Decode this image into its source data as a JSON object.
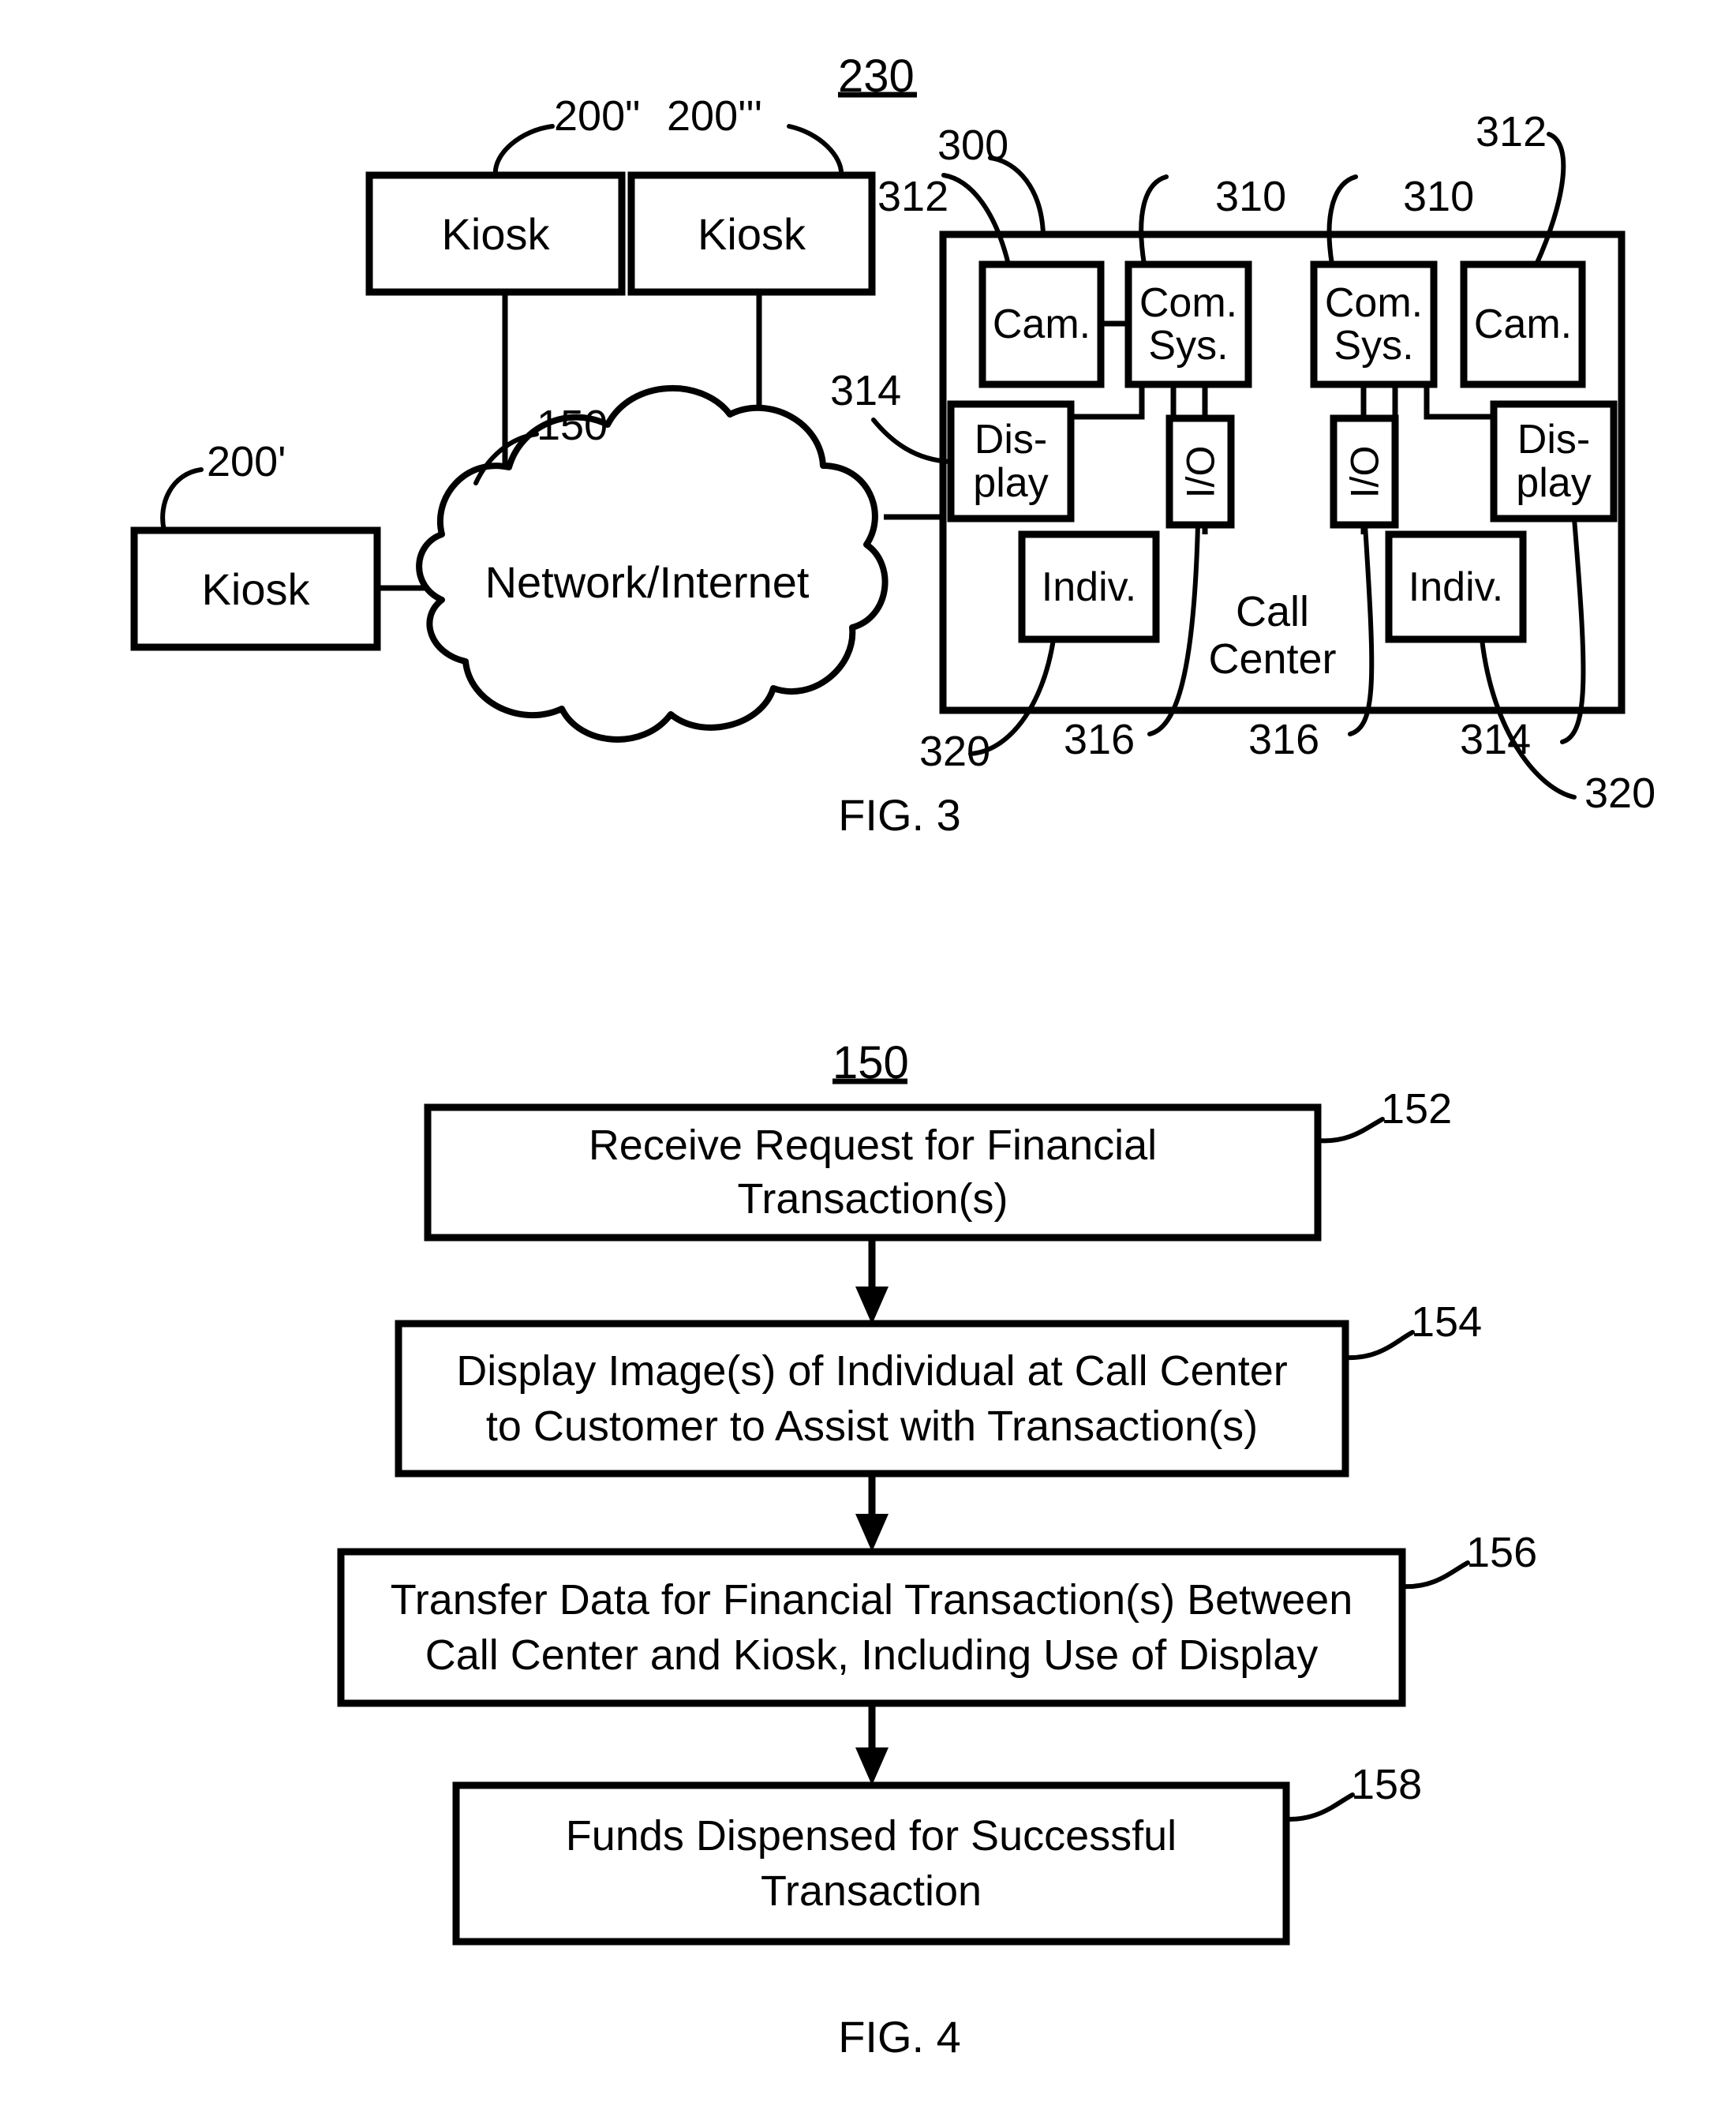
{
  "figures": [
    {
      "id": "fig3",
      "caption": "FIG. 3",
      "system_ref": "230",
      "nodes": {
        "kiosk_left": "Kiosk",
        "kiosk_mid": "Kiosk",
        "kiosk_right": "Kiosk",
        "network": "Network/Internet",
        "call_center": "Call Center",
        "cam_left": "Cam.",
        "cam_right": "Cam.",
        "comsys_left": "Com. Sys.",
        "comsys_left_line1": "Com.",
        "comsys_left_line2": "Sys.",
        "comsys_right_line1": "Com.",
        "comsys_right_line2": "Sys.",
        "display_left_line1": "Dis-",
        "display_left_line2": "play",
        "display_right_line1": "Dis-",
        "display_right_line2": "play",
        "io_left": "I/O",
        "io_right": "I/O",
        "indiv_left": "Indiv.",
        "indiv_right": "Indiv.",
        "call_center_line1": "Call",
        "call_center_line2": "Center"
      },
      "ref_numerals": {
        "kiosk_left": "200'",
        "kiosk_mid": "200\"",
        "kiosk_right": "200'''",
        "network": "150",
        "call_center_box": "300",
        "cam_left": "312",
        "cam_right": "312",
        "comsys_left": "310",
        "comsys_right": "310",
        "display_left": "314",
        "display_right": "314",
        "io_left": "316",
        "io_right": "316",
        "indiv_left": "320",
        "indiv_right": "320"
      }
    },
    {
      "id": "fig4",
      "caption": "FIG. 4",
      "method_ref": "150",
      "steps": [
        {
          "ref": "152",
          "line1": "Receive Request for Financial",
          "line2": "Transaction(s)"
        },
        {
          "ref": "154",
          "line1": "Display Image(s) of Individual at Call Center",
          "line2": "to Customer to Assist with Transaction(s)"
        },
        {
          "ref": "156",
          "line1": "Transfer Data for Financial Transaction(s) Between",
          "line2": "Call Center and Kiosk, Including Use of Display"
        },
        {
          "ref": "158",
          "line1": "Funds Dispensed for Successful",
          "line2": "Transaction"
        }
      ]
    }
  ],
  "colors": {
    "ink": "#000000",
    "paper": "#ffffff"
  }
}
